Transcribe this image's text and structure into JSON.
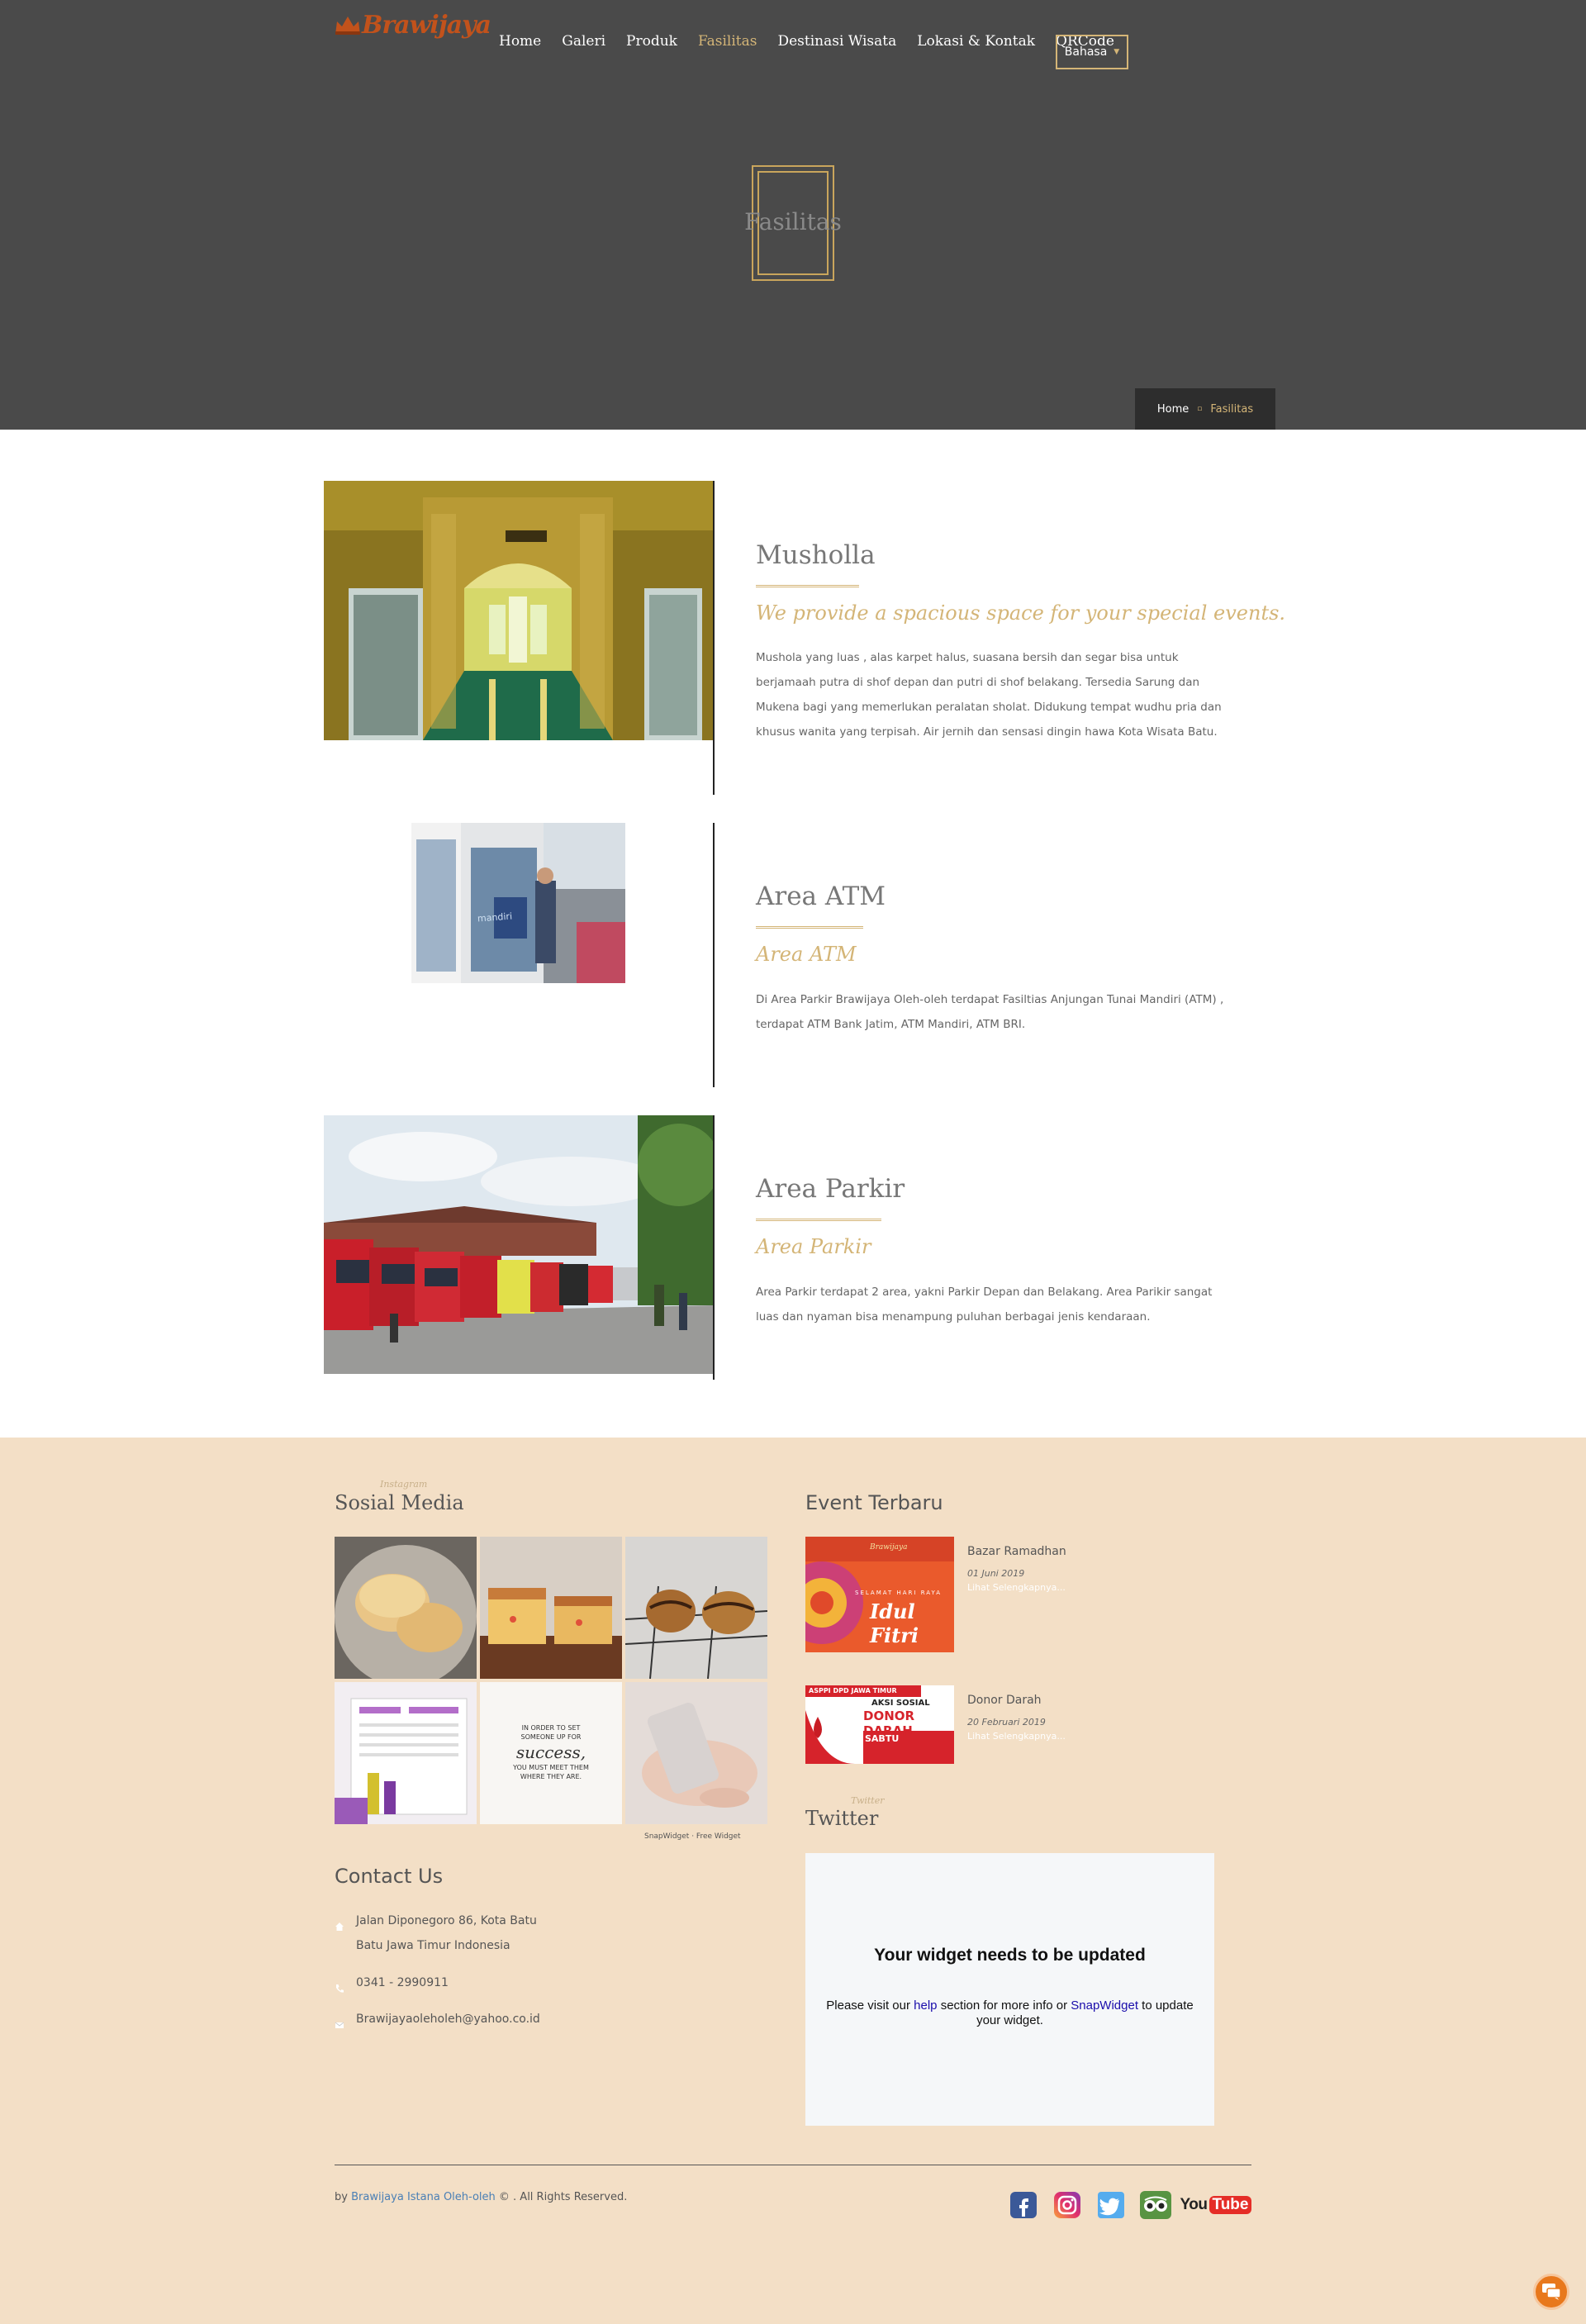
{
  "brand": {
    "logo_text": "Brawijaya"
  },
  "nav": {
    "items": [
      {
        "label": "Home",
        "active": false
      },
      {
        "label": "Galeri",
        "active": false
      },
      {
        "label": "Produk",
        "active": false
      },
      {
        "label": "Fasilitas",
        "active": true
      },
      {
        "label": "Destinasi Wisata",
        "active": false
      },
      {
        "label": "Lokasi & Kontak",
        "active": false
      },
      {
        "label": "QRCode",
        "active": false
      }
    ],
    "language_label": "Bahasa"
  },
  "hero": {
    "title": "Fasilitas"
  },
  "breadcrumb": {
    "home": "Home",
    "current": "Fasilitas"
  },
  "facilities": [
    {
      "title": "Musholla",
      "subtitle": "We provide a spacious space for your special events.",
      "description": "Mushola yang luas , alas karpet halus, suasana bersih dan segar bisa untuk berjamaah putra di shof depan dan putri di shof belakang. Tersedia Sarung dan Mukena bagi yang memerlukan peralatan sholat. Didukung tempat wudhu pria dan khusus wanita yang terpisah. Air jernih dan sensasi dingin hawa Kota Wisata Batu."
    },
    {
      "title": "Area ATM",
      "subtitle": "Area ATM",
      "description": "Di Area Parkir Brawijaya Oleh-oleh terdapat Fasiltias Anjungan Tunai Mandiri (ATM) , terdapat ATM Bank Jatim, ATM Mandiri, ATM BRI.",
      "image_text": "mandiri"
    },
    {
      "title": "Area Parkir",
      "subtitle": "Area Parkir",
      "description": "Area Parkir terdapat 2 area, yakni Parkir Depan dan Belakang. Area Parikir sangat luas dan nyaman bisa menampung puluhan berbagai jenis kendaraan."
    }
  ],
  "footer": {
    "social_media": {
      "small_label": "Instagram",
      "title": "Sosial Media",
      "quote_lines": [
        "IN ORDER TO SET",
        "SOMEONE UP FOR",
        "success,",
        "YOU MUST MEET THEM",
        "WHERE THEY ARE."
      ],
      "credit": "SnapWidget · Free Widget"
    },
    "contact": {
      "title": "Contact Us",
      "address_line1": "Jalan Diponegoro 86, Kota Batu",
      "address_line2": "Batu Jawa Timur Indonesia",
      "phone": "0341 - 2990911",
      "email": "Brawijayaoleholeh@yahoo.co.id"
    },
    "events": {
      "title": "Event Terbaru",
      "items": [
        {
          "name": "Bazar Ramadhan",
          "date": "01 Juni 2019",
          "more": "Lihat Selengkapnya...",
          "poster_top": "Brawijaya",
          "poster_greeting": "SELAMAT HARI RAYA",
          "poster_main": "Idul Fitri"
        },
        {
          "name": "Donor Darah",
          "date": "20 Februari 2019",
          "more": "Lihat Selengkapnya...",
          "poster_top": "ASPPI DPD JAWA TIMUR",
          "poster_greeting": "AKSI SOSIAL",
          "poster_main": "DONOR DARAH",
          "poster_day": "SABTU"
        }
      ]
    },
    "twitter": {
      "small_label": "Twitter",
      "title": "Twitter",
      "widget_heading": "Your widget needs to be updated",
      "widget_text_1": "Please visit our",
      "widget_link_1": "help",
      "widget_text_2": "section for more info or",
      "widget_link_2": "SnapWidget",
      "widget_text_3": "to update your widget."
    },
    "copyright": {
      "prefix": "by",
      "link": "Brawijaya Istana Oleh-oleh",
      "suffix": "© . All Rights Reserved."
    },
    "social_icons": [
      "facebook-icon",
      "instagram-icon",
      "twitter-icon",
      "tripadvisor-icon",
      "youtube-icon"
    ],
    "youtube": {
      "you": "You",
      "tube": "Tube"
    }
  },
  "colors": {
    "accent": "#d4b577",
    "hero_bg": "#4a4a4a",
    "footer_bg": "#f3dfc6",
    "chat": "#e8781c"
  }
}
